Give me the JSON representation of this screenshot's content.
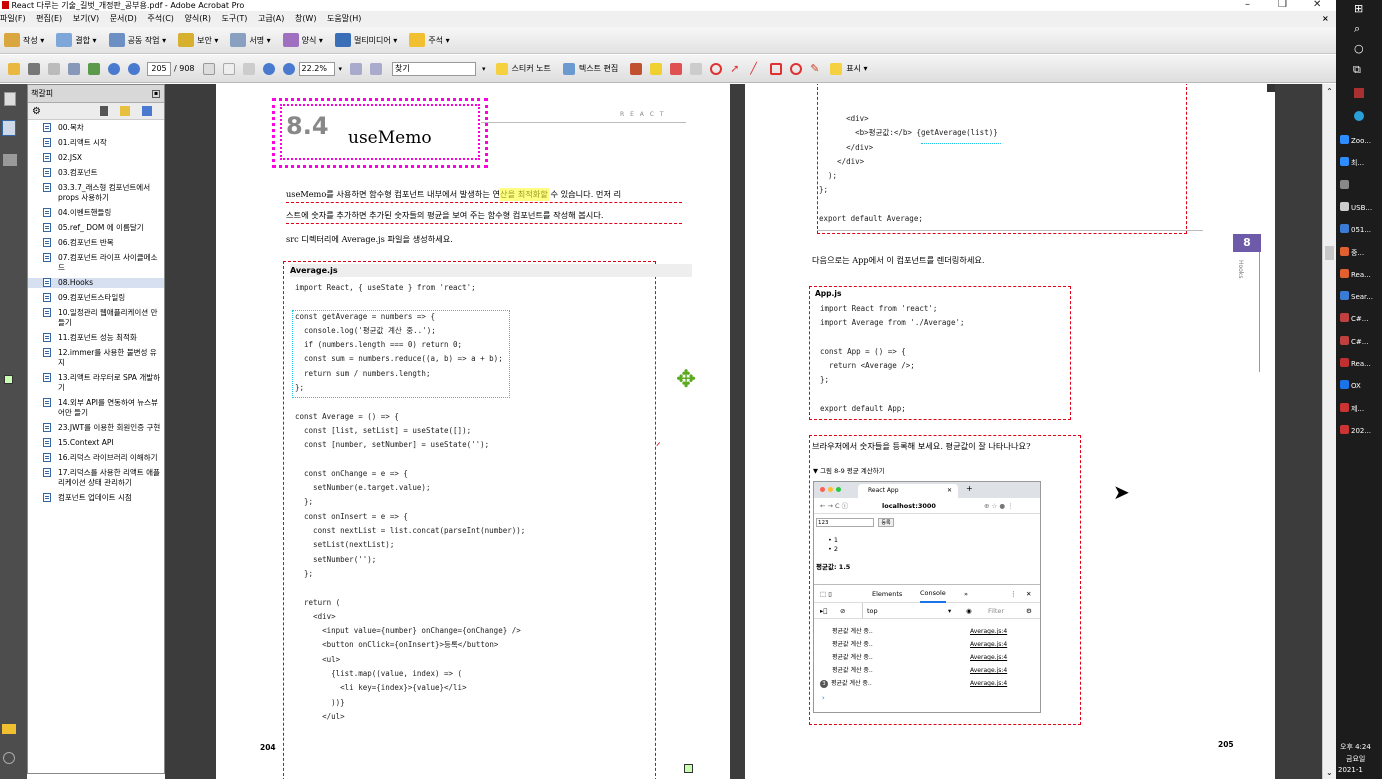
{
  "window": {
    "title": "React 다루는 기술_길벗_개정판_공부용.pdf - Adobe Acrobat Pro",
    "min": "–",
    "max": "❐",
    "close": "✕"
  },
  "menu": [
    "파일(F)",
    "편집(E)",
    "보기(V)",
    "문서(D)",
    "주석(C)",
    "양식(R)",
    "도구(T)",
    "고급(A)",
    "창(W)",
    "도움말(H)"
  ],
  "menu_close": "×",
  "toolbar1": {
    "create": "작성 ▾",
    "combine": "결합 ▾",
    "collaborate": "공동 작업 ▾",
    "secure": "보안 ▾",
    "sign": "서명 ▾",
    "forms": "양식 ▾",
    "multimedia": "멀티미디어 ▾",
    "comment": "주석 ▾"
  },
  "toolbar2": {
    "page_current": "205",
    "page_total": "/ 908",
    "zoom": "22.2%",
    "find_placeholder": "찾기",
    "sticky_note": "스티커 노트",
    "text_edit": "텍스트 편집",
    "show": "표시 ▾"
  },
  "bookmarks": {
    "title": "책갈피",
    "items": [
      {
        "label": "00.목차",
        "selected": false
      },
      {
        "label": "01.리액트 시작",
        "selected": false
      },
      {
        "label": "02.JSX",
        "selected": false
      },
      {
        "label": "03.컴포넌트",
        "selected": false
      },
      {
        "label": "03.3.7_래스형 컴포넌트에서 props 사용하기",
        "selected": false
      },
      {
        "label": "04.이벤트핸들링",
        "selected": false
      },
      {
        "label": "05.ref_ DOM 에 이름달기",
        "selected": false
      },
      {
        "label": "06.컴포넌트 반복",
        "selected": false
      },
      {
        "label": "07.컴포넌트 라이프 사이클메소드",
        "selected": false
      },
      {
        "label": "08.Hooks",
        "selected": true
      },
      {
        "label": "09.컴포넌트스타일링",
        "selected": false
      },
      {
        "label": "10.일정관리 웹애플리케이션 만들기",
        "selected": false
      },
      {
        "label": "11.컴포넌트 성능 최적화",
        "selected": false
      },
      {
        "label": "12.immer를 사용한 불변성 유지",
        "selected": false
      },
      {
        "label": "13.리액트 라우터로 SPA 개발하기",
        "selected": false
      },
      {
        "label": "14.외부 API를 연동하여 뉴스뷰어만 들기",
        "selected": false
      },
      {
        "label": "23.JWT를 이용한 회원인증 구현",
        "selected": false
      },
      {
        "label": "15.Context API",
        "selected": false
      },
      {
        "label": "16.리덕스 라이브러리 이해하기",
        "selected": false
      },
      {
        "label": "17.리덕스를 사용한 리액트 애플리케이션 상태 관리하기",
        "selected": false
      },
      {
        "label": "컴포넌트 업데이트 시점",
        "selected": false
      }
    ]
  },
  "left_page": {
    "section_no": "8.4",
    "section_title": "useMemo",
    "header_tag": "R E A C T",
    "para1": "useMemo를 사용하면 함수형 컴포넌트 내부에서 발생하는 연산을 최적화할 수 있습니다. 먼저 리",
    "para2": "스트에 숫자를 추가하면 추가된 숫자들의 평균을 보여 주는 함수형 컴포넌트를 작성해 봅시다.",
    "para3": "src 디렉터리에 Average.js 파일을 생성하세요.",
    "file_label": "Average.js",
    "code": [
      "import React, { useState } from 'react';",
      "",
      "const getAverage = numbers => {",
      "  console.log('평균값 계산 중..');",
      "  if (numbers.length === 0) return 0;",
      "  const sum = numbers.reduce((a, b) => a + b);",
      "  return sum / numbers.length;",
      "};",
      "",
      "const Average = () => {",
      "  const [list, setList] = useState([]);",
      "  const [number, setNumber] = useState('');",
      "",
      "  const onChange = e => {",
      "    setNumber(e.target.value);",
      "  };",
      "  const onInsert = e => {",
      "    const nextList = list.concat(parseInt(number));",
      "    setList(nextList);",
      "    setNumber('');",
      "  };",
      "",
      "  return (",
      "    <div>",
      "      <input value={number} onChange={onChange} />",
      "      <button onClick={onInsert}>등록</button>",
      "      <ul>",
      "        {list.map((value, index) => (",
      "          <li key={index}>{value}</li>",
      "        ))}",
      "      </ul>"
    ],
    "page_no": "204"
  },
  "right_page": {
    "code_top": [
      "      <div>",
      "        <b>평균값:</b> {getAverage(list)}",
      "      </div>",
      "    </div>",
      "  );",
      "};",
      "",
      "export default Average;"
    ],
    "chapter_tab": "8",
    "chapter_label": "Hooks",
    "para1": "다음으로는 App에서 이 컴포넌트를 렌더링하세요.",
    "file_label": "App.js",
    "app_code": [
      "import React from 'react';",
      "import Average from './Average';",
      "",
      "const App = () => {",
      "  return <Average />;",
      "};",
      "",
      "export default App;"
    ],
    "para2": "브라우저에서 숫자들을 등록해 보세요. 평균값이 잘 나타나나요?",
    "figure_caption": "▼ 그림 8-9 평균 계산하기",
    "page_no": "205",
    "browser": {
      "tab_title": "React App",
      "url": "localhost:3000",
      "input_value": "123",
      "button": "등록",
      "list": [
        "1",
        "2"
      ],
      "average": "평균값: 1.5",
      "devtools_tabs": [
        "Elements",
        "Console",
        "»"
      ],
      "context": "top",
      "filter": "Filter",
      "logs": [
        {
          "badge": "",
          "text": "평균값 계산 중..",
          "source": "Average.js:4"
        },
        {
          "badge": "",
          "text": "평균값 계산 중..",
          "source": "Average.js:4"
        },
        {
          "badge": "",
          "text": "평균값 계산 중..",
          "source": "Average.js:4"
        },
        {
          "badge": "",
          "text": "평균값 계산 중..",
          "source": "Average.js:4"
        },
        {
          "badge": "3",
          "text": "평균값 계산 중..",
          "source": "Average.js:4"
        }
      ],
      "prompt": "›"
    }
  },
  "taskbar": {
    "items": [
      "Zoo...",
      "최...",
      "",
      "USB...",
      "051...",
      "중...",
      "Rea...",
      "Sear...",
      "C#...",
      "C#...",
      "Rea...",
      "OX",
      "제...",
      "202..."
    ],
    "time": "오후 4:24",
    "day": "금요일",
    "date": "2021-1"
  },
  "colors": {
    "accent": "#e00018",
    "highlight": "#ffff33",
    "magenta": "#ff00e0",
    "cyan": "#1ec8e8"
  }
}
